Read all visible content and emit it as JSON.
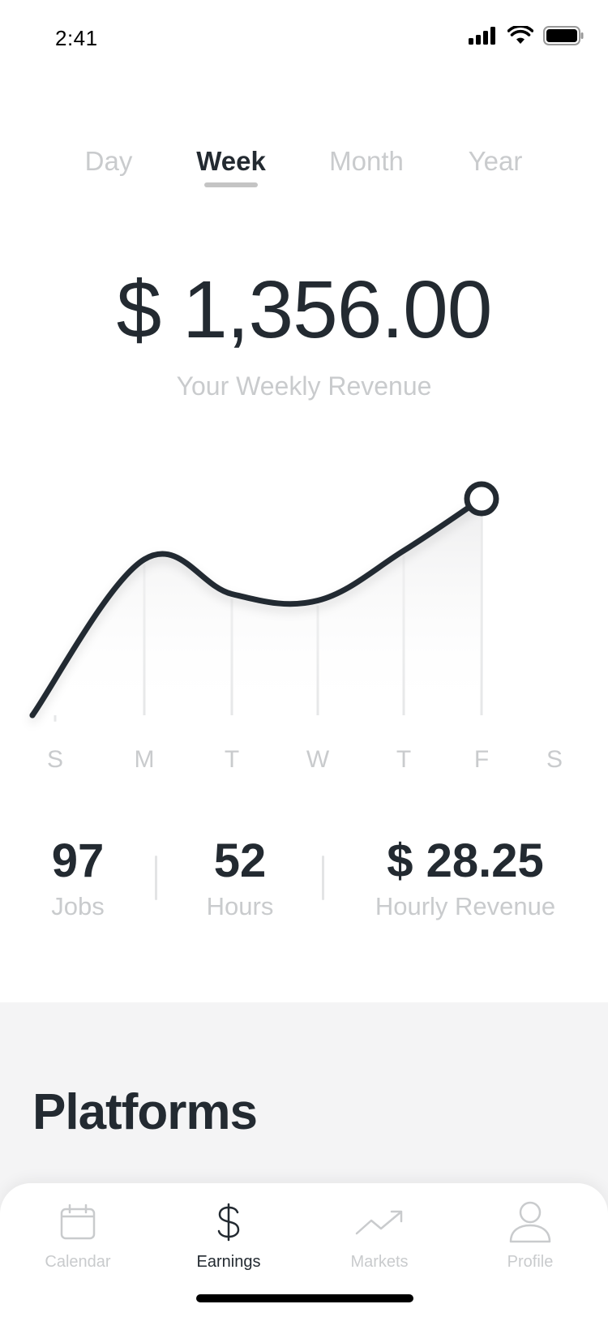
{
  "status_bar": {
    "time": "2:41"
  },
  "period_tabs": [
    {
      "label": "Day",
      "active": false
    },
    {
      "label": "Week",
      "active": true
    },
    {
      "label": "Month",
      "active": false
    },
    {
      "label": "Year",
      "active": false
    }
  ],
  "revenue": {
    "amount": "$ 1,356.00",
    "caption": "Your Weekly Revenue"
  },
  "chart_data": {
    "type": "line",
    "categories": [
      "S",
      "M",
      "T",
      "W",
      "T",
      "F",
      "S"
    ],
    "values": [
      0,
      720,
      560,
      530,
      760,
      1000,
      null
    ],
    "highlight_index": 5,
    "grid": true,
    "title": "",
    "xlabel": "",
    "ylabel": ""
  },
  "stats": [
    {
      "value": "97",
      "label": "Jobs"
    },
    {
      "value": "52",
      "label": "Hours"
    },
    {
      "value": "$ 28.25",
      "label": "Hourly Revenue"
    }
  ],
  "platforms": {
    "title": "Platforms"
  },
  "tab_bar": [
    {
      "label": "Calendar",
      "icon": "calendar-icon",
      "active": false
    },
    {
      "label": "Earnings",
      "icon": "dollar-icon",
      "active": true
    },
    {
      "label": "Markets",
      "icon": "trending-up-icon",
      "active": false
    },
    {
      "label": "Profile",
      "icon": "person-icon",
      "active": false
    }
  ],
  "colors": {
    "primary": "#232a31",
    "muted": "#c9cbcd",
    "section_bg": "#f4f4f5"
  }
}
